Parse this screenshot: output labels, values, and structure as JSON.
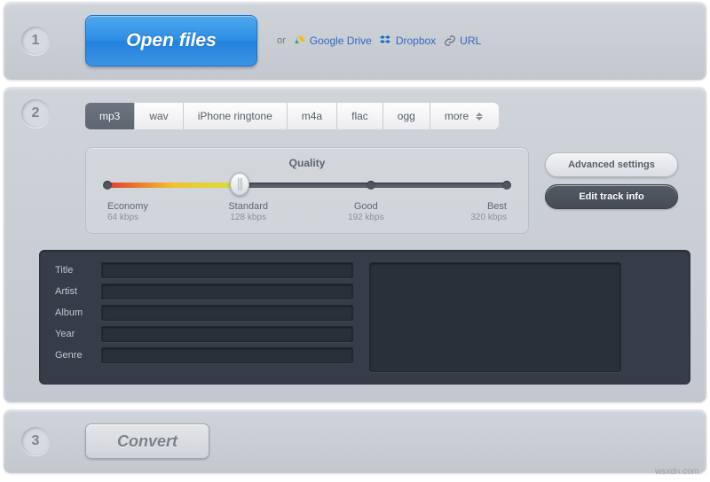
{
  "step1": {
    "num": "1",
    "open_label": "Open files",
    "or": "or",
    "gdrive": "Google Drive",
    "dropbox": "Dropbox",
    "url": "URL"
  },
  "step2": {
    "num": "2",
    "tabs": [
      "mp3",
      "wav",
      "iPhone ringtone",
      "m4a",
      "flac",
      "ogg",
      "more"
    ],
    "active_tab": 0,
    "quality_title": "Quality",
    "levels": [
      {
        "name": "Economy",
        "rate": "64 kbps",
        "pos": 0
      },
      {
        "name": "Standard",
        "rate": "128 kbps",
        "pos": 33
      },
      {
        "name": "Good",
        "rate": "192 kbps",
        "pos": 66
      },
      {
        "name": "Best",
        "rate": "320 kbps",
        "pos": 100
      }
    ],
    "selected_level": 1,
    "advanced": "Advanced settings",
    "edit_track": "Edit track info",
    "meta_labels": [
      "Title",
      "Artist",
      "Album",
      "Year",
      "Genre"
    ],
    "meta_values": [
      "",
      "",
      "",
      "",
      ""
    ]
  },
  "step3": {
    "num": "3",
    "convert": "Convert"
  },
  "watermark": "wsxdn.com"
}
